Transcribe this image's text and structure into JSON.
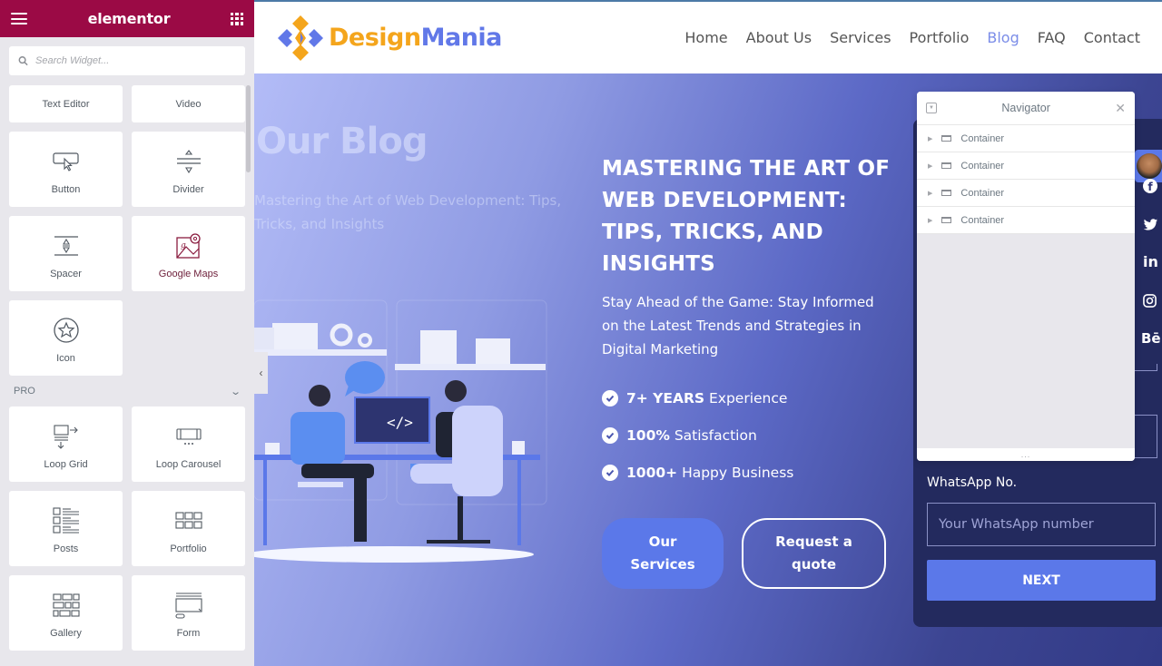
{
  "panel": {
    "logo": "elementor",
    "menu_icon": "hamburger-icon",
    "grid_icon": "apps-grid-icon",
    "search_placeholder": "Search Widget...",
    "widgets_top": [
      {
        "label": "Text Editor",
        "icon": "text-editor-icon"
      },
      {
        "label": "Video",
        "icon": "video-icon"
      }
    ],
    "widgets_basic": [
      {
        "label": "Button",
        "icon": "button-icon"
      },
      {
        "label": "Divider",
        "icon": "divider-icon"
      },
      {
        "label": "Spacer",
        "icon": "spacer-icon"
      },
      {
        "label": "Google Maps",
        "icon": "google-maps-icon"
      },
      {
        "label": "Icon",
        "icon": "star-icon"
      }
    ],
    "pro_section_label": "PRO",
    "widgets_pro": [
      {
        "label": "Loop Grid",
        "icon": "loop-grid-icon"
      },
      {
        "label": "Loop Carousel",
        "icon": "loop-carousel-icon"
      },
      {
        "label": "Posts",
        "icon": "posts-icon"
      },
      {
        "label": "Portfolio",
        "icon": "portfolio-icon"
      },
      {
        "label": "Gallery",
        "icon": "gallery-icon"
      },
      {
        "label": "Form",
        "icon": "form-icon"
      }
    ]
  },
  "site": {
    "brand_part1": "Design",
    "brand_part2": "Mania",
    "brand_colors": {
      "primary": "#f4a51c",
      "secondary": "#6178e8"
    },
    "nav": [
      {
        "label": "Home",
        "active": false
      },
      {
        "label": "About Us",
        "active": false
      },
      {
        "label": "Services",
        "active": false
      },
      {
        "label": "Portfolio",
        "active": false
      },
      {
        "label": "Blog",
        "active": true
      },
      {
        "label": "FAQ",
        "active": false
      },
      {
        "label": "Contact",
        "active": false
      }
    ],
    "ghost_title": "Our Blog",
    "ghost_subtitle": "Mastering the Art of Web Development: Tips, Tricks, and Insights",
    "hero_title": "MASTERING THE ART OF WEB DEVELOPMENT: TIPS, TRICKS, AND INSIGHTS",
    "hero_description": "Stay Ahead of the Game: Stay Informed on the Latest Trends and Strategies in Digital Marketing",
    "features": [
      {
        "bold": "7+ YEARS",
        "text": " Experience"
      },
      {
        "bold": "100%",
        "text": " Satisfaction"
      },
      {
        "bold": "1000+",
        "text": " Happy Business"
      }
    ],
    "btn_services": "Our Services",
    "btn_quote": "Request a quote",
    "code_symbol": "</>",
    "form": {
      "whatsapp_label": "WhatsApp No.",
      "whatsapp_placeholder": "Your WhatsApp number",
      "next_label": "NEXT"
    },
    "social": [
      {
        "icon": "facebook-icon",
        "glyph": "f"
      },
      {
        "icon": "twitter-icon",
        "glyph": "🐦"
      },
      {
        "icon": "linkedin-icon",
        "glyph": "in"
      },
      {
        "icon": "instagram-icon",
        "glyph": "◎"
      },
      {
        "icon": "behance-icon",
        "glyph": "Bē"
      }
    ],
    "accent_color": "#5b78e9"
  },
  "navigator": {
    "title": "Navigator",
    "items": [
      {
        "label": "Container"
      },
      {
        "label": "Container"
      },
      {
        "label": "Container"
      },
      {
        "label": "Container"
      }
    ],
    "footer_handle": "..."
  }
}
